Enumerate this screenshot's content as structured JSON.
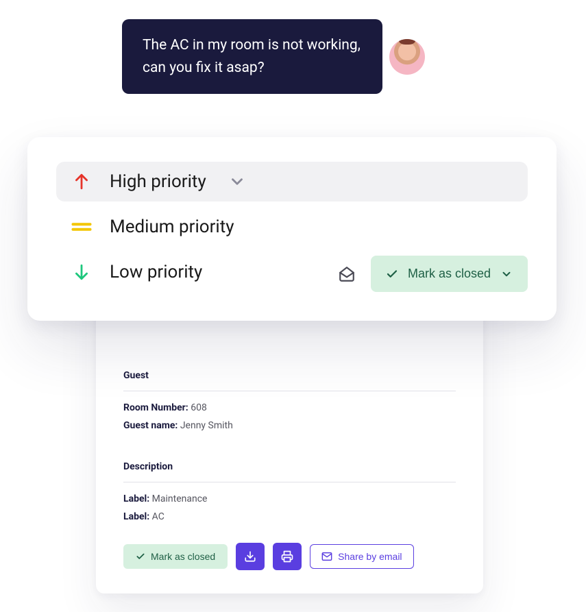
{
  "chat": {
    "message": "The AC in my room is not working, can you fix it asap?"
  },
  "priority": {
    "items": [
      {
        "label": "High priority"
      },
      {
        "label": "Medium priority"
      },
      {
        "label": "Low priority"
      }
    ],
    "mark_closed_label": "Mark as closed"
  },
  "detail": {
    "guest_heading": "Guest",
    "room_label": "Room Number:",
    "room_value": "608",
    "guest_name_label": "Guest name:",
    "guest_name_value": "Jenny Smith",
    "desc_heading": "Description",
    "label1_label": "Label:",
    "label1_value": "Maintenance",
    "label2_label": "Label:",
    "label2_value": "AC",
    "mark_closed_label": "Mark as closed",
    "share_label": "Share by email"
  }
}
